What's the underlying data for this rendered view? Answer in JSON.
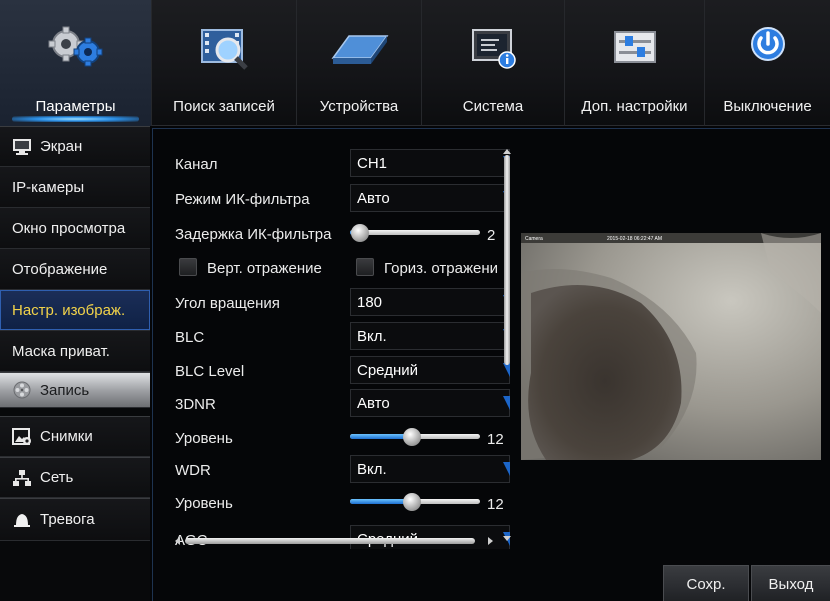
{
  "top_menu": {
    "tabs": [
      {
        "label": "Параметры",
        "icon": "gears-icon",
        "active": true
      },
      {
        "label": "Поиск записей",
        "icon": "film-search-icon",
        "active": false
      },
      {
        "label": "Устройства",
        "icon": "hdd-icon",
        "active": false
      },
      {
        "label": "Система",
        "icon": "system-info-icon",
        "active": false
      },
      {
        "label": "Доп. настройки",
        "icon": "sliders-icon",
        "active": false
      },
      {
        "label": "Выключение",
        "icon": "power-icon",
        "active": false
      }
    ]
  },
  "sidebar": {
    "items": [
      {
        "label": "Экран",
        "icon": "monitor-icon",
        "kind": "group"
      },
      {
        "label": "IP-камеры",
        "kind": "item"
      },
      {
        "label": "Окно просмотра",
        "kind": "item"
      },
      {
        "label": "Отображение",
        "kind": "item"
      },
      {
        "label": "Настр. изображ.",
        "kind": "item",
        "active": true
      },
      {
        "label": "Маска приват.",
        "kind": "item"
      },
      {
        "label": "Запись",
        "icon": "film-reel-icon",
        "kind": "group"
      },
      {
        "label": "Снимки",
        "icon": "snapshot-icon",
        "kind": "group"
      },
      {
        "label": "Сеть",
        "icon": "network-icon",
        "kind": "group"
      },
      {
        "label": "Тревога",
        "icon": "alarm-icon",
        "kind": "group"
      }
    ]
  },
  "settings": {
    "channel": {
      "label": "Канал",
      "value": "CH1"
    },
    "ir_mode": {
      "label": "Режим ИК-фильтра",
      "value": "Авто"
    },
    "ir_delay": {
      "label": "Задержка ИК-фильтра",
      "value": "2",
      "level": 0.08
    },
    "flip_v": {
      "label": "Верт. отражение",
      "checked": false
    },
    "flip_h": {
      "label": "Гориз. отражени",
      "checked": false
    },
    "rotation": {
      "label": "Угол вращения",
      "value": "180"
    },
    "blc": {
      "label": "BLC",
      "value": "Вкл."
    },
    "blc_level": {
      "label": "BLC Level",
      "value": "Средний"
    },
    "dnr": {
      "label": "3DNR",
      "value": "Авто"
    },
    "dnr_level": {
      "label": "Уровень",
      "value": "12",
      "level": 0.48
    },
    "wdr": {
      "label": "WDR",
      "value": "Вкл."
    },
    "wdr_level": {
      "label": "Уровень",
      "value": "12",
      "level": 0.48
    },
    "agc": {
      "label": "AGC",
      "value": "Средний"
    }
  },
  "preview": {
    "camera_name": "Camera",
    "timestamp": "2015-02-18 06:22:47 AM"
  },
  "buttons": {
    "save": "Сохр.",
    "exit": "Выход"
  },
  "colors": {
    "accent_blue": "#1c66c9",
    "active_text": "#f2d34a"
  }
}
